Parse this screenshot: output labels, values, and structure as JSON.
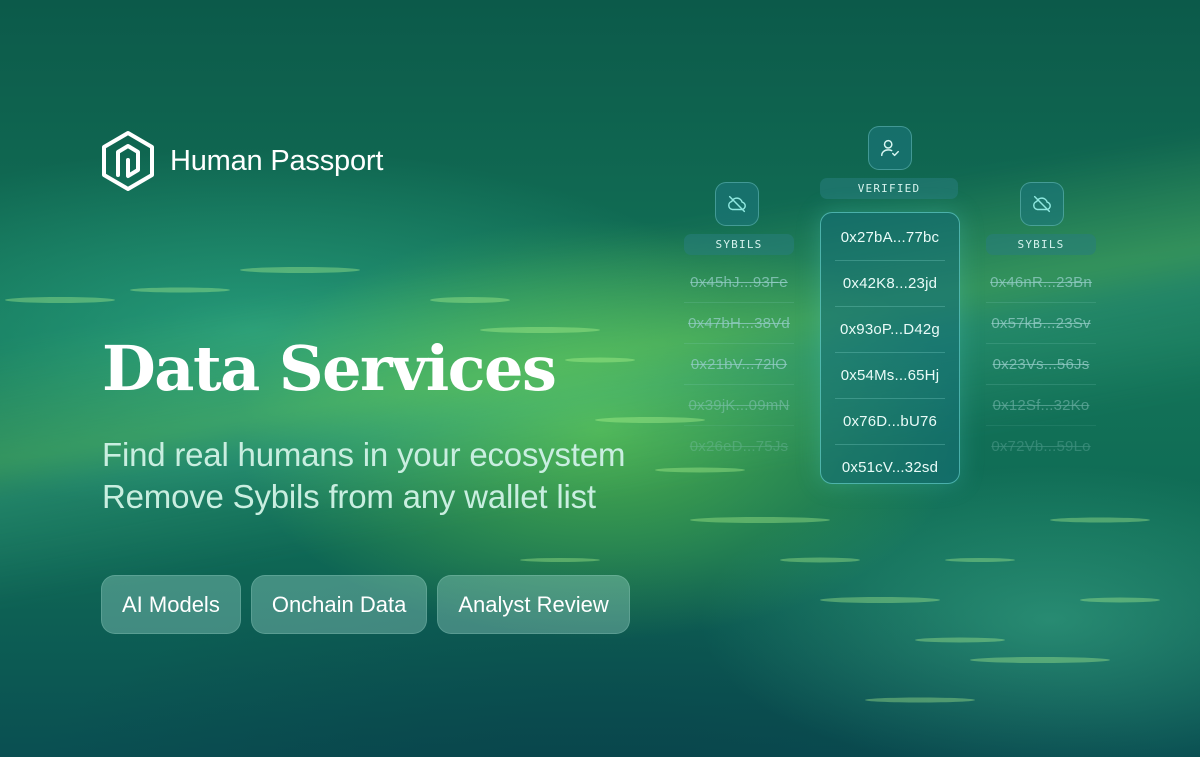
{
  "brand": {
    "name": "Human Passport",
    "logo_icon": "hexagon-spiral-icon"
  },
  "hero": {
    "title": "Data Services",
    "subtitle_line1": "Find real humans in your ecosystem",
    "subtitle_line2": "Remove Sybils from any wallet list"
  },
  "pills": [
    {
      "label": "AI Models"
    },
    {
      "label": "Onchain Data"
    },
    {
      "label": "Analyst Review"
    }
  ],
  "columns": {
    "left": {
      "label": "SYBILS",
      "icon": "cloud-off-icon",
      "addresses": [
        "0x45hJ...93Fe",
        "0x47bH...38Vd",
        "0x21bV...72lO",
        "0x39jK...09mN",
        "0x26eD...75Js"
      ]
    },
    "center": {
      "label": "VERIFIED",
      "icon": "user-check-icon",
      "addresses": [
        "0x27bA...77bc",
        "0x42K8...23jd",
        "0x93oP...D42g",
        "0x54Ms...65Hj",
        "0x76D...bU76",
        "0x51cV...32sd"
      ]
    },
    "right": {
      "label": "SYBILS",
      "icon": "cloud-off-icon",
      "addresses": [
        "0x46nR...23Bn",
        "0x57kB...23Sv",
        "0x23Vs...56Js",
        "0x12Sf...32Ko",
        "0x72Vb...59Lo"
      ]
    }
  },
  "colors": {
    "accent": "#7de646",
    "background": "#0f6550",
    "text": "#ffffff"
  }
}
